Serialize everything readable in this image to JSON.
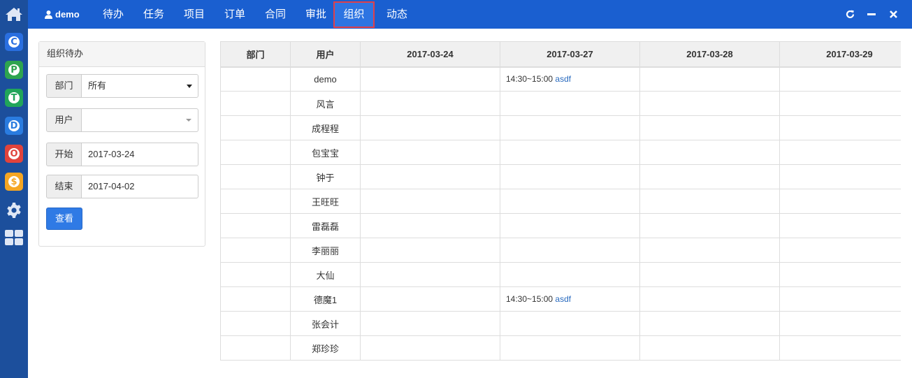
{
  "sidebar": {
    "home_icon": "home-icon",
    "apps": [
      {
        "name": "app-c",
        "letter": "C",
        "color": "#2a6fe0",
        "icon": "c-icon"
      },
      {
        "name": "app-p",
        "letter": "P",
        "color": "#2ea44f",
        "icon": "p-icon"
      },
      {
        "name": "app-t",
        "letter": "T",
        "color": "#21a55a",
        "icon": "t-icon"
      },
      {
        "name": "app-d",
        "letter": "D",
        "color": "#2a7ce0",
        "icon": "d-icon"
      },
      {
        "name": "app-o",
        "letter": "O",
        "color": "#e0433c",
        "icon": "o-icon"
      },
      {
        "name": "app-s",
        "letter": "$",
        "color": "#f5a623",
        "icon": "dollar-icon"
      }
    ],
    "settings_icon": "gear-icon",
    "grid_icon": "grid-icon"
  },
  "header": {
    "user": "demo",
    "nav": [
      "待办",
      "任务",
      "项目",
      "订单",
      "合同",
      "审批",
      "组织",
      "动态"
    ],
    "active": "组织"
  },
  "panel": {
    "title": "组织待办",
    "dept_label": "部门",
    "dept_value": "所有",
    "user_label": "用户",
    "user_value": "",
    "start_label": "开始",
    "start_value": "2017-03-24",
    "end_label": "结束",
    "end_value": "2017-04-02",
    "view_button": "查看"
  },
  "table": {
    "headers": [
      "部门",
      "用户",
      "2017-03-24",
      "2017-03-27",
      "2017-03-28",
      "2017-03-29"
    ],
    "rows": [
      {
        "dept": "",
        "user": "demo",
        "d1": "",
        "d2_time": "14:30~15:00",
        "d2_text": "asdf",
        "d3": "",
        "d4": ""
      },
      {
        "dept": "",
        "user": "风言",
        "d1": "",
        "d2_time": "",
        "d2_text": "",
        "d3": "",
        "d4": ""
      },
      {
        "dept": "",
        "user": "成程程",
        "d1": "",
        "d2_time": "",
        "d2_text": "",
        "d3": "",
        "d4": ""
      },
      {
        "dept": "",
        "user": "包宝宝",
        "d1": "",
        "d2_time": "",
        "d2_text": "",
        "d3": "",
        "d4": ""
      },
      {
        "dept": "",
        "user": "钟于",
        "d1": "",
        "d2_time": "",
        "d2_text": "",
        "d3": "",
        "d4": ""
      },
      {
        "dept": "",
        "user": "王旺旺",
        "d1": "",
        "d2_time": "",
        "d2_text": "",
        "d3": "",
        "d4": ""
      },
      {
        "dept": "",
        "user": "雷磊磊",
        "d1": "",
        "d2_time": "",
        "d2_text": "",
        "d3": "",
        "d4": ""
      },
      {
        "dept": "",
        "user": "李丽丽",
        "d1": "",
        "d2_time": "",
        "d2_text": "",
        "d3": "",
        "d4": ""
      },
      {
        "dept": "",
        "user": "大仙",
        "d1": "",
        "d2_time": "",
        "d2_text": "",
        "d3": "",
        "d4": ""
      },
      {
        "dept": "",
        "user": "德魔1",
        "d1": "",
        "d2_time": "14:30~15:00",
        "d2_text": "asdf",
        "d3": "",
        "d4": ""
      },
      {
        "dept": "",
        "user": "张会计",
        "d1": "",
        "d2_time": "",
        "d2_text": "",
        "d3": "",
        "d4": ""
      },
      {
        "dept": "",
        "user": "郑珍珍",
        "d1": "",
        "d2_time": "",
        "d2_text": "",
        "d3": "",
        "d4": ""
      }
    ]
  },
  "window": {
    "refresh_icon": "refresh-icon",
    "minimize_icon": "minimize-icon",
    "close_icon": "close-icon"
  },
  "colors": {
    "topbar": "#1a5fd0",
    "sidebar": "#1c4f9c",
    "active_border": "#e0404a",
    "link": "#2a6bbf",
    "button": "#2f7ae5"
  }
}
